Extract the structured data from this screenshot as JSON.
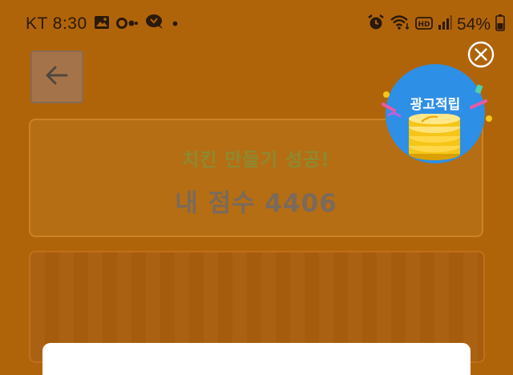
{
  "status_bar": {
    "carrier_time": "KT 8:30",
    "dot": "•",
    "battery": "54%",
    "icons": [
      "gallery-icon",
      "oo-icon",
      "talk-icon",
      "alarm-icon",
      "wifi-icon",
      "hd-icon",
      "signal-icon",
      "battery-icon"
    ]
  },
  "game": {
    "success_message": "치킨 만들기 성공!",
    "score_label": "내 점수 4406"
  },
  "ad_badge": {
    "label": "광고적립"
  },
  "colors": {
    "overlay_bg": "#b0640a",
    "ad_blue": "#2e8fe6",
    "coin_gold": "#f5c518"
  }
}
